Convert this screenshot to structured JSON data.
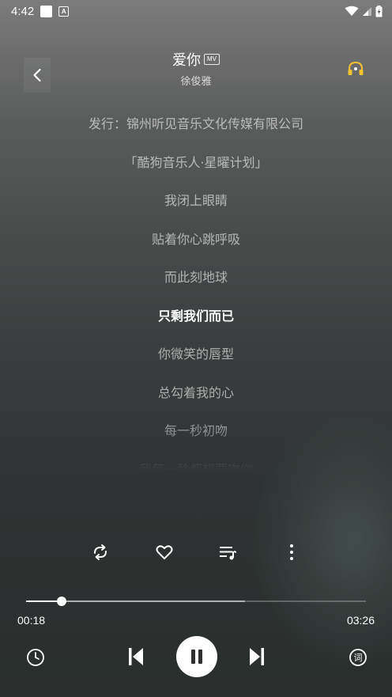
{
  "status_bar": {
    "time": "4:42",
    "icons": [
      "square-notification-icon",
      "a-notification-icon",
      "wifi-icon",
      "signal-icon",
      "battery-icon"
    ]
  },
  "header": {
    "title": "爱你",
    "mv_badge": "MV",
    "artist": "徐俊雅",
    "icons": [
      "back-icon",
      "headphones-icon"
    ]
  },
  "lyrics": {
    "lines": [
      "发行：锦州听见音乐文化传媒有限公司",
      "「酷狗音乐人·星曜计划」",
      "我闭上眼睛",
      "贴着你心跳呼吸",
      "而此刻地球",
      "只剩我们而已",
      "你微笑的唇型",
      "总勾着我的心",
      "每一秒初吻",
      "我每一秒都想要吻你"
    ],
    "active_index": 5
  },
  "actions": {
    "icons": [
      "repeat-icon",
      "heart-icon",
      "playlist-icon",
      "more-icon"
    ]
  },
  "progress": {
    "current": "00:18",
    "total": "03:26",
    "played_fraction": 0.105,
    "buffered_fraction": 0.645
  },
  "controls": {
    "icons": [
      "timer-icon",
      "previous-icon",
      "pause-icon",
      "next-icon",
      "lyrics-icon"
    ],
    "lyrics_glyph": "词"
  },
  "colors": {
    "accent": "#ffffff",
    "background_top": "#7b7b7b",
    "background_bottom": "#2a2f2e"
  }
}
